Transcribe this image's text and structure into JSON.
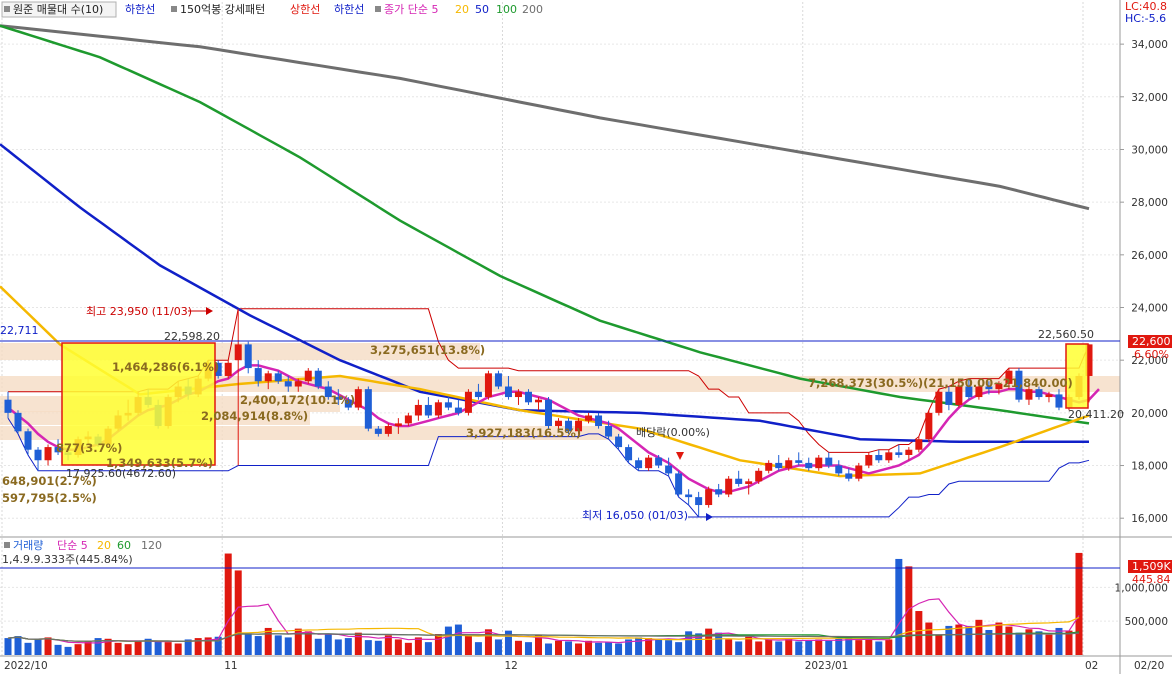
{
  "colors": {
    "up": "#e0180f",
    "down": "#1f5fd6",
    "ma5": "#d526b4",
    "ma20": "#f5b800",
    "ma50": "#1020c8",
    "ma100": "#1e9a2e",
    "ma200": "#6e6e6e",
    "band": "#cc0000",
    "lowband": "#1020c8",
    "highlight_fill": "#ffff33",
    "highlight_stroke": "#e0180f",
    "zone": "#f5dcc4"
  },
  "price_legend": {
    "box_label": "원준 매물대 수(10)",
    "item1": "하한선",
    "item2": "150억봉 강세패턴",
    "item3": "상한선",
    "item4": "하한선",
    "item5": "종가 단순 5",
    "p20": "20",
    "p50": "50",
    "p100": "100",
    "p200": "200"
  },
  "volume_legend": {
    "title": "거래량",
    "ma_label": "단순 5",
    "p20": "20",
    "p60": "60",
    "p120": "120",
    "value_text": "1,4.9.9.333주(445.84%)"
  },
  "corner": {
    "lc": "LC:40.8",
    "hc": "HC:-5.6"
  },
  "right_tags": {
    "price": "22,600",
    "pct": "6.60%",
    "volume": "1,509K",
    "volume_pct": "445.84"
  },
  "annotations": {
    "high": "최고 23,950 (11/03)",
    "low": "최저 16,050 (01/03)",
    "dividend": "배당락(0.00%)",
    "level_left": "22,711",
    "level_high_close": "22,598.20",
    "level_right": "22,560.50",
    "level_right2": "20,411.20",
    "mid_low": "17,925.60(4672.60)",
    "zone1": "1,464,286(6.1%)",
    "zone2": "3,275,651(13.8%)",
    "zone3": "2,400,172(10.1%)",
    "zone4": "2,084,914(8.8%)",
    "zone5": "3,927,183(16.5%)",
    "zone6": "7,268,373(30.5%)(21,150.00~21,840.00)",
    "zone7": "648,901(2.7%)",
    "zone8": "597,795(2.5%)",
    "zone9": "877(3.7%)",
    "zone10": "1,349,633(5.7%)"
  },
  "chart_data": [
    {
      "type": "candlestick",
      "title": "원준 매물대 수(10)",
      "ylim": [
        15400,
        35600
      ],
      "y_ticks": [
        16000,
        18000,
        20000,
        22000,
        24000,
        26000,
        28000,
        30000,
        32000,
        34000
      ],
      "y_tick_labels": [
        "16,000",
        "18,000",
        "20,000",
        "22,000",
        "24,000",
        "26,000",
        "28,000",
        "30,000",
        "32,000",
        "34,000"
      ],
      "x_labels": [
        "2022/10",
        "11",
        "12",
        "2023/01",
        "02",
        "02/20"
      ],
      "x_label_index": [
        0,
        22,
        50,
        80,
        108,
        128
      ],
      "candles": [
        [
          20500,
          20800,
          19800,
          20000
        ],
        [
          20000,
          20100,
          19200,
          19300
        ],
        [
          19300,
          19400,
          18400,
          18600
        ],
        [
          18600,
          18700,
          17800,
          18200
        ],
        [
          18200,
          18800,
          18000,
          18700
        ],
        [
          18700,
          19000,
          18400,
          18500
        ],
        [
          18500,
          18700,
          18200,
          18400
        ],
        [
          18400,
          19100,
          18300,
          19000
        ],
        [
          19000,
          19300,
          18800,
          19100
        ],
        [
          19100,
          19200,
          18700,
          18800
        ],
        [
          18800,
          19500,
          18700,
          19400
        ],
        [
          19400,
          20100,
          19300,
          19900
        ],
        [
          19900,
          20500,
          19700,
          20000
        ],
        [
          20000,
          20800,
          19900,
          20600
        ],
        [
          20600,
          20900,
          20200,
          20300
        ],
        [
          20300,
          20500,
          19400,
          19500
        ],
        [
          19500,
          20700,
          19400,
          20600
        ],
        [
          20600,
          21200,
          20400,
          21000
        ],
        [
          21000,
          21300,
          20500,
          20700
        ],
        [
          20700,
          21400,
          20600,
          21300
        ],
        [
          21300,
          22000,
          21200,
          21900
        ],
        [
          21900,
          22000,
          21300,
          21400
        ],
        [
          21400,
          22000,
          21300,
          21900
        ],
        [
          22000,
          23950,
          18000,
          22600
        ],
        [
          22600,
          22700,
          21500,
          21700
        ],
        [
          21700,
          22000,
          21000,
          21200
        ],
        [
          21200,
          21600,
          20900,
          21500
        ],
        [
          21500,
          21600,
          21100,
          21200
        ],
        [
          21200,
          21400,
          20800,
          21000
        ],
        [
          21000,
          21300,
          20800,
          21200
        ],
        [
          21200,
          21700,
          21100,
          21600
        ],
        [
          21600,
          21700,
          20900,
          21000
        ],
        [
          21000,
          21200,
          20500,
          20600
        ],
        [
          20600,
          20900,
          20300,
          20500
        ],
        [
          20500,
          20600,
          20100,
          20200
        ],
        [
          20200,
          21000,
          20100,
          20900
        ],
        [
          20900,
          21000,
          19300,
          19400
        ],
        [
          19400,
          19500,
          19100,
          19200
        ],
        [
          19200,
          19600,
          19100,
          19500
        ],
        [
          19500,
          19800,
          19200,
          19600
        ],
        [
          19600,
          20000,
          19500,
          19900
        ],
        [
          19900,
          20500,
          19700,
          20300
        ],
        [
          20300,
          20600,
          19800,
          19900
        ],
        [
          19900,
          20500,
          19800,
          20400
        ],
        [
          20400,
          20600,
          20100,
          20200
        ],
        [
          20200,
          20500,
          19900,
          20000
        ],
        [
          20000,
          20900,
          19900,
          20800
        ],
        [
          20800,
          21100,
          20500,
          20600
        ],
        [
          20600,
          21600,
          20500,
          21500
        ],
        [
          21500,
          21600,
          20900,
          21000
        ],
        [
          21000,
          21400,
          20500,
          20600
        ],
        [
          20600,
          20900,
          20300,
          20800
        ],
        [
          20800,
          20900,
          20300,
          20400
        ],
        [
          20400,
          20600,
          20100,
          20500
        ],
        [
          20500,
          20600,
          19400,
          19500
        ],
        [
          19500,
          19800,
          19300,
          19700
        ],
        [
          19700,
          19800,
          19200,
          19300
        ],
        [
          19300,
          19800,
          19200,
          19700
        ],
        [
          19700,
          20000,
          19600,
          19900
        ],
        [
          19900,
          20000,
          19400,
          19500
        ],
        [
          19500,
          19700,
          19000,
          19100
        ],
        [
          19100,
          19200,
          18600,
          18700
        ],
        [
          18700,
          18800,
          18100,
          18200
        ],
        [
          18200,
          18300,
          17800,
          17900
        ],
        [
          17900,
          18400,
          17800,
          18300
        ],
        [
          18300,
          18400,
          17900,
          18000
        ],
        [
          18000,
          18300,
          17600,
          17700
        ],
        [
          17700,
          17800,
          16800,
          16900
        ],
        [
          16900,
          17100,
          16500,
          16800
        ],
        [
          16800,
          17000,
          16050,
          16500
        ],
        [
          16500,
          17200,
          16400,
          17100
        ],
        [
          17100,
          17300,
          16800,
          16900
        ],
        [
          16900,
          17600,
          16800,
          17500
        ],
        [
          17500,
          17800,
          17200,
          17300
        ],
        [
          17300,
          17500,
          16900,
          17400
        ],
        [
          17400,
          17900,
          17300,
          17800
        ],
        [
          17800,
          18200,
          17700,
          18100
        ],
        [
          18100,
          18400,
          17800,
          17900
        ],
        [
          17900,
          18300,
          17800,
          18200
        ],
        [
          18200,
          18500,
          18000,
          18100
        ],
        [
          18100,
          18300,
          17800,
          17900
        ],
        [
          17900,
          18400,
          17800,
          18300
        ],
        [
          18300,
          18500,
          17900,
          18000
        ],
        [
          18000,
          18200,
          17600,
          17700
        ],
        [
          17700,
          17900,
          17400,
          17500
        ],
        [
          17500,
          18100,
          17400,
          18000
        ],
        [
          18000,
          18500,
          17900,
          18400
        ],
        [
          18400,
          18600,
          18100,
          18200
        ],
        [
          18200,
          18600,
          18100,
          18500
        ],
        [
          18500,
          18800,
          18300,
          18400
        ],
        [
          18400,
          18700,
          18200,
          18600
        ],
        [
          18600,
          19100,
          18500,
          19000
        ],
        [
          19000,
          20100,
          18900,
          20000
        ],
        [
          20000,
          20900,
          19900,
          20800
        ],
        [
          20800,
          21000,
          20100,
          20300
        ],
        [
          20300,
          21200,
          20200,
          21000
        ],
        [
          21000,
          21300,
          20500,
          20600
        ],
        [
          20600,
          21100,
          20500,
          21000
        ],
        [
          21000,
          21200,
          20700,
          20900
        ],
        [
          20900,
          21200,
          20700,
          21100
        ],
        [
          21100,
          21700,
          20900,
          21600
        ],
        [
          21600,
          21700,
          20400,
          20500
        ],
        [
          20500,
          21000,
          20300,
          20900
        ],
        [
          20900,
          21000,
          20500,
          20600
        ],
        [
          20600,
          20800,
          20400,
          20700
        ],
        [
          20700,
          20900,
          20100,
          20200
        ],
        [
          20200,
          20700,
          20100,
          20600
        ],
        [
          20600,
          21500,
          20500,
          21400
        ],
        [
          21400,
          22600,
          20400,
          22600
        ]
      ],
      "ma5": [
        20200,
        19900,
        19600,
        19200,
        18900,
        18700,
        18600,
        18600,
        18700,
        18800,
        19000,
        19300,
        19600,
        19900,
        20100,
        20200,
        20300,
        20500,
        20700,
        20800,
        21000,
        21200,
        21300,
        21600,
        21800,
        21800,
        21700,
        21600,
        21400,
        21200,
        21100,
        21000,
        20900,
        20700,
        20500,
        20300,
        20100,
        19800,
        19600,
        19500,
        19500,
        19600,
        19700,
        19800,
        19900,
        20000,
        20200,
        20400,
        20600,
        20700,
        20800,
        20800,
        20700,
        20600,
        20500,
        20300,
        20100,
        19900,
        19800,
        19700,
        19600,
        19400,
        19100,
        18800,
        18500,
        18300,
        18100,
        17800,
        17500,
        17300,
        17100,
        17000,
        17000,
        17100,
        17200,
        17400,
        17600,
        17800,
        17900,
        18000,
        18000,
        18000,
        18000,
        18000,
        17900,
        17800,
        17700,
        17800,
        17900,
        18000,
        18200,
        18400,
        18800,
        19300,
        19800,
        20200,
        20500,
        20700,
        20800,
        20800,
        20900,
        20900,
        20800,
        20800,
        20700,
        20600,
        20500,
        20400,
        20500,
        20900
      ]
    },
    {
      "type": "bar",
      "title": "거래량",
      "ylim": [
        0,
        1700000
      ],
      "y_ticks": [
        500000,
        1000000
      ],
      "y_tick_labels": [
        "500,000",
        "1,000,000"
      ],
      "values": [
        250000,
        280000,
        180000,
        230000,
        260000,
        150000,
        120000,
        160000,
        210000,
        250000,
        240000,
        180000,
        160000,
        210000,
        240000,
        200000,
        190000,
        170000,
        230000,
        250000,
        260000,
        270000,
        1500000,
        1250000,
        320000,
        280000,
        400000,
        290000,
        260000,
        390000,
        350000,
        240000,
        310000,
        230000,
        250000,
        330000,
        220000,
        210000,
        290000,
        230000,
        180000,
        260000,
        190000,
        310000,
        420000,
        450000,
        280000,
        190000,
        380000,
        230000,
        360000,
        210000,
        190000,
        300000,
        170000,
        210000,
        200000,
        170000,
        210000,
        180000,
        190000,
        170000,
        230000,
        260000,
        250000,
        240000,
        220000,
        190000,
        350000,
        320000,
        390000,
        330000,
        230000,
        200000,
        270000,
        200000,
        230000,
        200000,
        240000,
        200000,
        210000,
        230000,
        210000,
        240000,
        250000,
        220000,
        230000,
        200000,
        230000,
        1420000,
        1310000,
        650000,
        480000,
        290000,
        430000,
        450000,
        430000,
        520000,
        370000,
        480000,
        420000,
        330000,
        380000,
        350000,
        300000,
        400000,
        360000,
        1509000
      ]
    }
  ]
}
